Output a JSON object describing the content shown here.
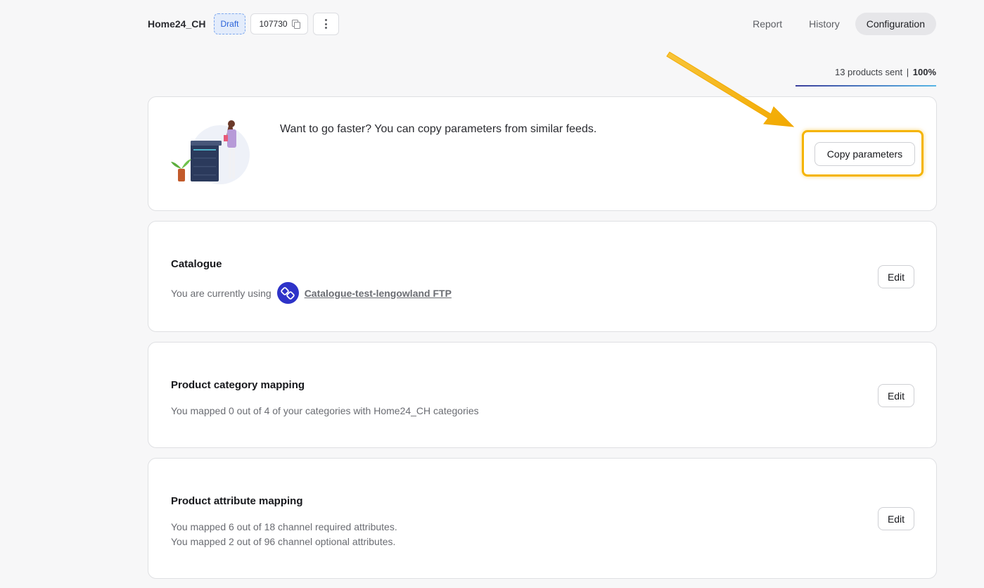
{
  "header": {
    "feed_name": "Home24_CH",
    "status_badge": "Draft",
    "feed_id": "107730",
    "tabs": [
      "Report",
      "History",
      "Configuration"
    ],
    "active_tab": "Configuration"
  },
  "progress": {
    "sent_text": "13 products sent",
    "separator": "|",
    "percent_text": "100%",
    "fraction": 1.0
  },
  "copy_card": {
    "text": "Want to go faster? You can copy parameters from similar feeds.",
    "button_label": "Copy parameters"
  },
  "catalogue_card": {
    "title": "Catalogue",
    "prefix": "You are currently using",
    "link": "Catalogue-test-lengowland FTP",
    "edit_label": "Edit"
  },
  "category_card": {
    "title": "Product category mapping",
    "text": "You mapped 0 out of 4 of your categories with Home24_CH categories",
    "edit_label": "Edit"
  },
  "attribute_card": {
    "title": "Product attribute mapping",
    "line1": "You mapped 6 out of 18 channel required attributes.",
    "line2": "You mapped 2 out of 96 channel optional attributes.",
    "edit_label": "Edit"
  },
  "colors": {
    "accent_highlight": "#f5b400",
    "draft_badge": "#2b63d9",
    "ftp_icon": "#2e33c8"
  }
}
